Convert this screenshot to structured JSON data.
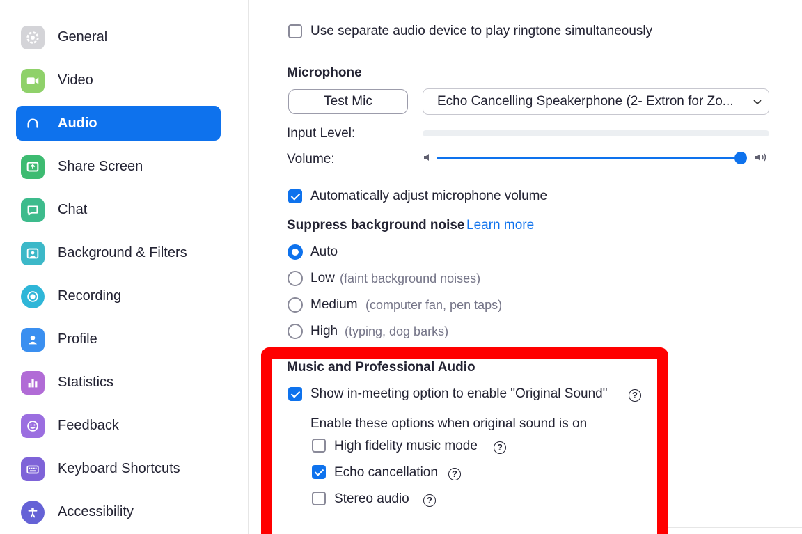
{
  "sidebar": {
    "items": [
      {
        "label": "General",
        "icon": "gear-icon",
        "color": "#cfcfd4",
        "active": false
      },
      {
        "label": "Video",
        "icon": "video-camera-icon",
        "color": "#8fd16a",
        "active": false
      },
      {
        "label": "Audio",
        "icon": "headphones-icon",
        "color": "#0e72ed",
        "active": true
      },
      {
        "label": "Share Screen",
        "icon": "share-screen-icon",
        "color": "#3dbb71",
        "active": false
      },
      {
        "label": "Chat",
        "icon": "chat-bubble-icon",
        "color": "#3dbb8c",
        "active": false
      },
      {
        "label": "Background & Filters",
        "icon": "person-background-icon",
        "color": "#3cb8c8",
        "active": false
      },
      {
        "label": "Recording",
        "icon": "record-icon",
        "color": "#2fb6d8",
        "active": false
      },
      {
        "label": "Profile",
        "icon": "profile-icon",
        "color": "#3a8ff0",
        "active": false
      },
      {
        "label": "Statistics",
        "icon": "bar-chart-icon",
        "color": "#b16bd6",
        "active": false
      },
      {
        "label": "Feedback",
        "icon": "smiley-icon",
        "color": "#9b6ee0",
        "active": false
      },
      {
        "label": "Keyboard Shortcuts",
        "icon": "keyboard-icon",
        "color": "#7e63d8",
        "active": false
      },
      {
        "label": "Accessibility",
        "icon": "accessibility-icon",
        "color": "#6562d6",
        "active": false
      }
    ]
  },
  "audio": {
    "separate_device": {
      "label": "Use separate audio device to play ringtone simultaneously",
      "checked": false
    },
    "microphone": {
      "heading": "Microphone",
      "test_button": "Test Mic",
      "device": "Echo Cancelling Speakerphone (2- Extron for Zo...",
      "input_level_label": "Input Level:",
      "volume_label": "Volume:",
      "volume_level": 1.0
    },
    "auto_adjust": {
      "label": "Automatically adjust microphone volume",
      "checked": true
    },
    "noise": {
      "heading": "Suppress background noise",
      "learn_more": "Learn more",
      "options": [
        {
          "label": "Auto",
          "hint": "",
          "selected": true
        },
        {
          "label": "Low",
          "hint": "(faint background noises)",
          "selected": false
        },
        {
          "label": "Medium",
          "hint": "(computer fan, pen taps)",
          "selected": false
        },
        {
          "label": "High",
          "hint": "(typing, dog barks)",
          "selected": false
        }
      ]
    },
    "music": {
      "heading": "Music and Professional Audio",
      "original_sound": {
        "label": "Show in-meeting option to enable \"Original Sound\"",
        "checked": true
      },
      "sub_heading": "Enable these options when original sound is on",
      "options": [
        {
          "label": "High fidelity music mode",
          "checked": false
        },
        {
          "label": "Echo cancellation",
          "checked": true
        },
        {
          "label": "Stereo audio",
          "checked": false
        }
      ]
    },
    "help_glyph": "?"
  },
  "colors": {
    "accent": "#0e72ed",
    "highlight": "#ff0000"
  }
}
